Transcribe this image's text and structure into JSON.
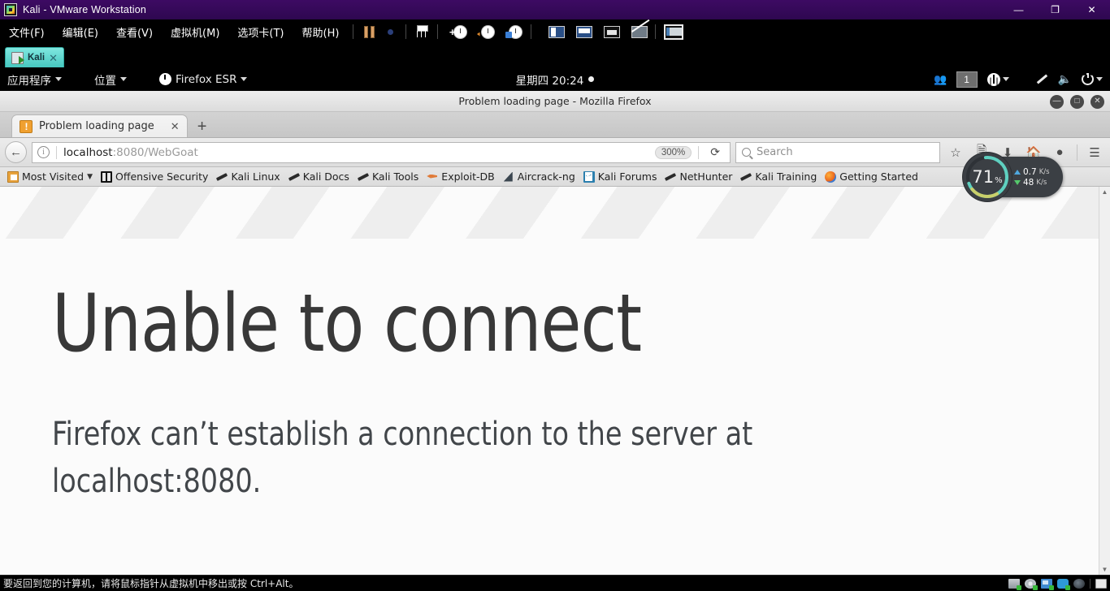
{
  "vmware": {
    "title": "Kali - VMware Workstation",
    "window_controls": [
      {
        "name": "minimize",
        "glyph": "—"
      },
      {
        "name": "restore",
        "glyph": "❐"
      },
      {
        "name": "close",
        "glyph": "✕"
      }
    ],
    "menu": [
      {
        "label": "文件(F)"
      },
      {
        "label": "编辑(E)"
      },
      {
        "label": "查看(V)"
      },
      {
        "label": "虚拟机(M)"
      },
      {
        "label": "选项卡(T)"
      },
      {
        "label": "帮助(H)"
      }
    ],
    "toolbar_icons": [
      "pause-icon",
      "power-dot-icon",
      "network-adapter-icon",
      "snapshot-take-icon",
      "snapshot-revert-icon",
      "snapshot-manager-icon",
      "view-console-icon",
      "view-fullscreen-icon",
      "view-stretch-icon",
      "view-multimonitor-icon",
      "unity-mode-icon"
    ],
    "tab": {
      "label": "Kali",
      "close": "✕"
    },
    "statusbar": {
      "text": "要返回到您的计算机，请将鼠标指针从虚拟机中移出或按 Ctrl+Alt。",
      "devices": [
        "harddisk-icon",
        "cdrom-icon",
        "network-icon",
        "usb-icon",
        "sound-icon",
        "printer-icon"
      ]
    }
  },
  "kali_panel": {
    "applications": "应用程序",
    "places": "位置",
    "firefox": "Firefox ESR",
    "clock": "星期四 20:24",
    "workspace": "1",
    "tray_icons": [
      "users-icon",
      "workspace-indicator",
      "accessibility-icon",
      "pen-icon",
      "volume-icon",
      "power-icon"
    ]
  },
  "firefox": {
    "window_title": "Problem loading page - Mozilla Firefox",
    "window_controls": [
      {
        "name": "minimize",
        "glyph": "—"
      },
      {
        "name": "maximize",
        "glyph": "□"
      },
      {
        "name": "close",
        "glyph": "✕"
      }
    ],
    "tab": {
      "title": "Problem loading page",
      "close": "✕",
      "favicon": "warning-page-icon"
    },
    "new_tab": "+",
    "nav": {
      "back": "←",
      "identity_icon": "i",
      "url_host": "localhost",
      "url_rest": ":8080/WebGoat",
      "url_full": "localhost:8080/WebGoat",
      "zoom_level": "300%",
      "reload": "⟳",
      "search_placeholder": "Search",
      "icons": [
        "bookmark-star-icon",
        "library-icon",
        "downloads-icon",
        "home-icon",
        "pocket-icon",
        "menu-hamburger-icon"
      ]
    },
    "bookmarks": [
      {
        "label": "Most Visited",
        "icon": "mostvisited",
        "caret": true
      },
      {
        "label": "Offensive Security",
        "icon": "offsec",
        "caret": false
      },
      {
        "label": "Kali Linux",
        "icon": "dragon",
        "caret": false
      },
      {
        "label": "Kali Docs",
        "icon": "dragon",
        "caret": false
      },
      {
        "label": "Kali Tools",
        "icon": "dragon",
        "caret": false
      },
      {
        "label": "Exploit-DB",
        "icon": "exploit",
        "caret": false
      },
      {
        "label": "Aircrack-ng",
        "icon": "aircrack",
        "caret": false
      },
      {
        "label": "Kali Forums",
        "icon": "forums",
        "caret": false
      },
      {
        "label": "NetHunter",
        "icon": "dragon",
        "caret": false
      },
      {
        "label": "Kali Training",
        "icon": "dragon",
        "caret": false
      },
      {
        "label": "Getting Started",
        "icon": "getting",
        "caret": false
      }
    ],
    "page": {
      "heading": "Unable to connect",
      "description": "Firefox can’t establish a connection to the server at localhost:8080."
    },
    "scrollbar": {
      "up": "▲",
      "down": "▼"
    }
  },
  "perf_widget": {
    "cpu_percent": "71",
    "percent_symbol": "%",
    "upload": "0.7",
    "upload_unit": "K/s",
    "download": "48",
    "download_unit": "K/s",
    "ring_color": "#5fd0c0",
    "ring_color2": "#c9cf6a"
  }
}
